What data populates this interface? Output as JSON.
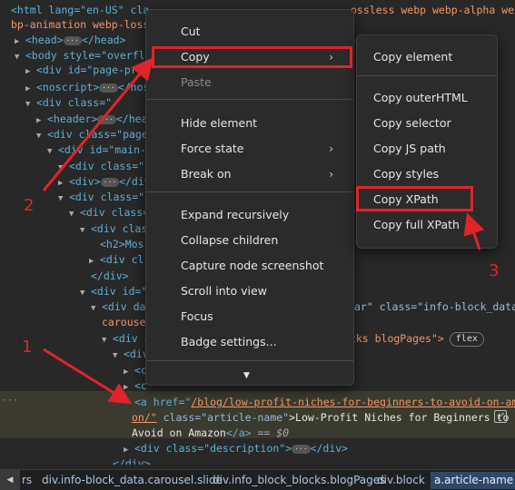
{
  "dom_tree": {
    "l1": "<html lang=\"en-US\" cla",
    "l1b": "ossless webp webp-alpha we",
    "l2": "bp-animation webp-loss",
    "head": "<head>",
    "head_close": "</head>",
    "body_open": "<body style=\"overflo",
    "div_id": "<div id=\"page-pre",
    "noscript": "<noscript>",
    "noscript_close": "</nos",
    "div_class": "<div class=\"",
    "header": "<header>",
    "header_close": "</head",
    "page": "<div class=\"page",
    "main": "<div id=\"main-p",
    "div_j1": "<div class=\"j",
    "div_j1_b": "<div>",
    "div_j1_c": "</div>",
    "div_j2": "<div class=\"j",
    "div_class2": "<div class=",
    "div_clas3": "<div clas",
    "h2": "<h2>Mos",
    "div_cl": "<div cl",
    "div_close": "</div>",
    "div_id2": "<div id=\"",
    "div_da": "<div da",
    "div_da_tail_1": "ar\" class=\"info-block_data",
    "carousel": "carousel",
    "div_c": "<div c",
    "div_c_tail": "ocks blogPages\">",
    "flex_badge": "flex",
    "div_e": "<div",
    "div_f": "<c",
    "div_g": "<c",
    "a_open": "<a href=\"",
    "a_href": "/blog/low-profit-niches-for-beginners-to-avoid-on-amaz",
    "a_href2": "on/\"",
    "a_class": " class=\"article-name\"",
    "a_text": ">Low-Profit Niches for Beginners to",
    "a_text2": "Avoid on Amazon",
    "a_close": "</a>",
    "eq": " == $0",
    "desc": "<div class=\"description\">",
    "desc_close": "</div>",
    "body_close": "</div>"
  },
  "context_menu": {
    "cut": "Cut",
    "copy": "Copy",
    "paste": "Paste",
    "hide_element": "Hide element",
    "force_state": "Force state",
    "break_on": "Break on",
    "expand_recursively": "Expand recursively",
    "collapse_children": "Collapse children",
    "capture_node_screenshot": "Capture node screenshot",
    "scroll_into_view": "Scroll into view",
    "focus": "Focus",
    "badge_settings": "Badge settings..."
  },
  "copy_submenu": {
    "copy_element": "Copy element",
    "copy_outerhtml": "Copy outerHTML",
    "copy_selector": "Copy selector",
    "copy_js_path": "Copy JS path",
    "copy_styles": "Copy styles",
    "copy_xpath": "Copy XPath",
    "copy_full_xpath": "Copy full XPath"
  },
  "annotations": {
    "n1": "1",
    "n2": "2",
    "n3": "3"
  },
  "breadcrumbs": {
    "c0": "rs",
    "c1": "div.info-block_data.carousel.slide",
    "c2": "div.info_block_blocks.blogPages",
    "c3": "div.block",
    "c4": "a.article-name"
  },
  "colors": {
    "annotation_red": "#e0242a",
    "selected_crumb": "#2f4868"
  }
}
